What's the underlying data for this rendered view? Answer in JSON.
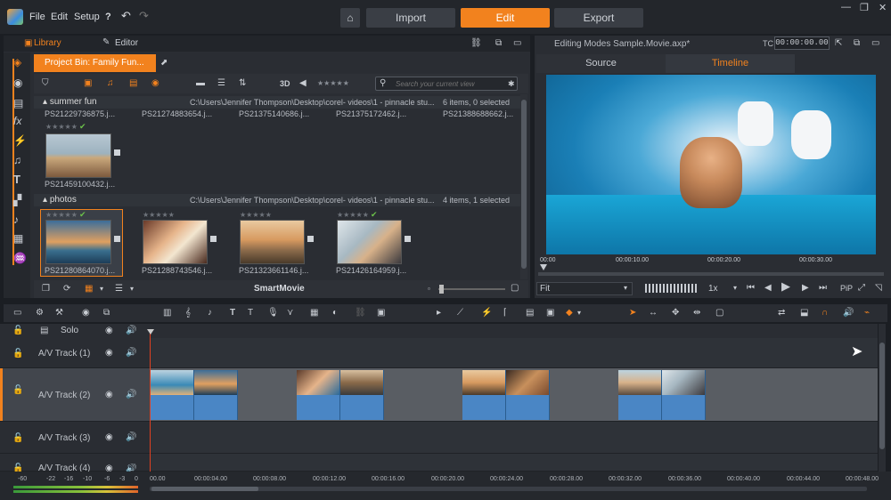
{
  "menu": {
    "file": "File",
    "edit": "Edit",
    "setup": "Setup",
    "help": "?"
  },
  "modes": {
    "import": "Import",
    "edit": "Edit",
    "export": "Export"
  },
  "library": {
    "tab_library": "Library",
    "tab_editor": "Editor",
    "bin_tab": "Project Bin: Family Fun...",
    "view_3d": "3D",
    "rating": "★★★★★",
    "search_placeholder": "Search your current view",
    "groups": [
      {
        "name": "summer fun",
        "path": "C:\\Users\\Jennifer Thompson\\Desktop\\corel- videos\\1 - pinnacle stu...",
        "count": "6 items, 0 selected",
        "files": [
          "PS21229736875.j...",
          "PS21274883654.j...",
          "PS21375140686.j...",
          "PS21375172462.j...",
          "PS21388688662.j..."
        ],
        "thumb_file": "PS21459100432.j..."
      },
      {
        "name": "photos",
        "path": "C:\\Users\\Jennifer Thompson\\Desktop\\corel- videos\\1 - pinnacle stu...",
        "count": "4 items, 1 selected",
        "files": [
          "PS21280864070.j...",
          "PS21288743546.j...",
          "PS21323661146.j...",
          "PS21426164959.j..."
        ]
      }
    ],
    "smartmovie": "SmartMovie"
  },
  "preview": {
    "title": "Editing Modes Sample.Movie.axp*",
    "tc_label": "TC",
    "timecode": "00:00:00.00",
    "tab_source": "Source",
    "tab_timeline": "Timeline",
    "ruler": [
      "00:00",
      "00:00:10.00",
      "00:00:20.00",
      "00:00:30.00"
    ],
    "fit": "Fit",
    "speed": "1x",
    "pip": "PiP"
  },
  "timeline": {
    "solo": "Solo",
    "tracks": [
      "A/V Track (1)",
      "A/V Track (2)",
      "A/V Track (3)",
      "A/V Track (4)"
    ],
    "ruler": [
      "00.00",
      "00:00:04.00",
      "00:00:08.00",
      "00:00:12.00",
      "00:00:16.00",
      "00:00:20.00",
      "00:00:24.00",
      "00:00:28.00",
      "00:00:32.00",
      "00:00:36.00",
      "00:00:40.00",
      "00:00:44.00",
      "00:00:48.00"
    ],
    "meter": [
      "-60",
      "-22",
      "-16",
      "-10",
      "-6",
      "-3",
      "0"
    ]
  },
  "colors": {
    "accent": "#f2821e",
    "clip": "#4a86c5",
    "panel": "#2a2d33"
  }
}
